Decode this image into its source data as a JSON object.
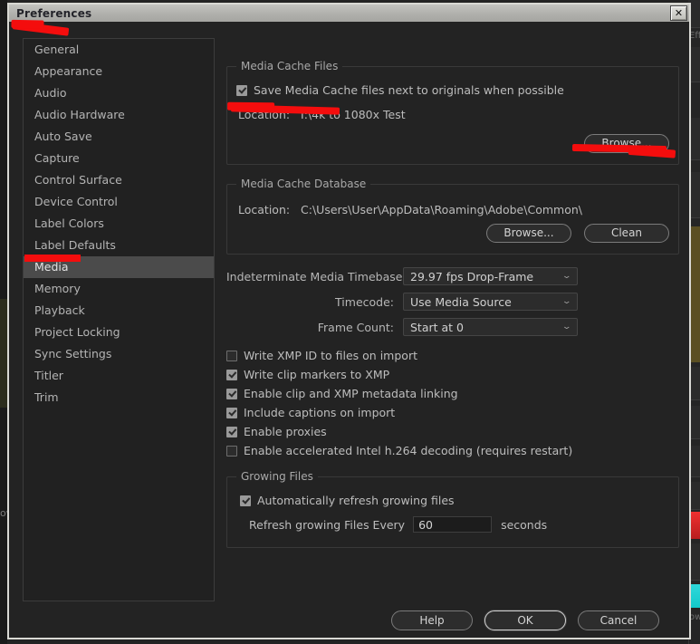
{
  "window": {
    "title": "Preferences",
    "close_label": "✕"
  },
  "background": {
    "effects_label": "Eff",
    "ow_label": "ow"
  },
  "sidebar": {
    "items": [
      {
        "label": "General",
        "selected": false
      },
      {
        "label": "Appearance",
        "selected": false
      },
      {
        "label": "Audio",
        "selected": false
      },
      {
        "label": "Audio Hardware",
        "selected": false
      },
      {
        "label": "Auto Save",
        "selected": false
      },
      {
        "label": "Capture",
        "selected": false
      },
      {
        "label": "Control Surface",
        "selected": false
      },
      {
        "label": "Device Control",
        "selected": false
      },
      {
        "label": "Label Colors",
        "selected": false
      },
      {
        "label": "Label Defaults",
        "selected": false
      },
      {
        "label": "Media",
        "selected": true
      },
      {
        "label": "Memory",
        "selected": false
      },
      {
        "label": "Playback",
        "selected": false
      },
      {
        "label": "Project Locking",
        "selected": false
      },
      {
        "label": "Sync Settings",
        "selected": false
      },
      {
        "label": "Titler",
        "selected": false
      },
      {
        "label": "Trim",
        "selected": false
      }
    ]
  },
  "media_cache_files": {
    "legend": "Media Cache Files",
    "save_next_to_originals": {
      "label": "Save Media Cache files next to originals when possible",
      "checked": true
    },
    "location_key": "Location:",
    "location_value": "I:\\4k to 1080x Test",
    "browse_label": "Browse..."
  },
  "media_cache_database": {
    "legend": "Media Cache Database",
    "location_key": "Location:",
    "location_value": "C:\\Users\\User\\AppData\\Roaming\\Adobe\\Common\\",
    "browse_label": "Browse...",
    "clean_label": "Clean"
  },
  "fields": [
    {
      "label": "Indeterminate Media Timebase:",
      "value": "29.97 fps Drop-Frame"
    },
    {
      "label": "Timecode:",
      "value": "Use Media Source"
    },
    {
      "label": "Frame Count:",
      "value": "Start at 0"
    }
  ],
  "options": [
    {
      "label": "Write XMP ID to files on import",
      "checked": false
    },
    {
      "label": "Write clip markers to XMP",
      "checked": true
    },
    {
      "label": "Enable clip and XMP metadata linking",
      "checked": true
    },
    {
      "label": "Include captions on import",
      "checked": true
    },
    {
      "label": "Enable proxies",
      "checked": true
    },
    {
      "label": "Enable accelerated Intel h.264 decoding (requires restart)",
      "checked": false
    }
  ],
  "growing_files": {
    "legend": "Growing Files",
    "auto_refresh": {
      "label": "Automatically refresh growing files",
      "checked": true
    },
    "refresh_label": "Refresh growing Files Every",
    "refresh_value": "60",
    "seconds_label": "seconds"
  },
  "footer": {
    "help_label": "Help",
    "ok_label": "OK",
    "cancel_label": "Cancel"
  },
  "annotation_color": "#f40d0d"
}
